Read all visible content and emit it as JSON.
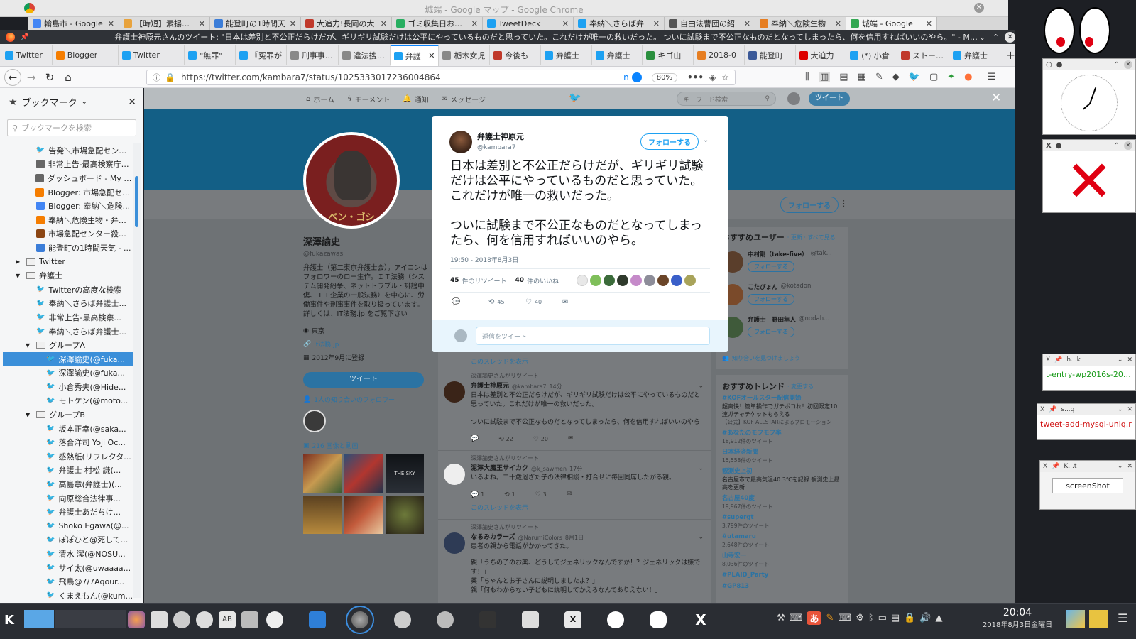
{
  "chrome": {
    "title": "城端 - Google マップ - Google Chrome",
    "tabs": [
      "輪島市 - Google",
      "【時短】素揚げさ",
      "能登町の1時間天",
      "大追力!長岡の大",
      "ゴミ収集日お知ら",
      "TweetDeck",
      "奉納＼さらば弁",
      "自由法曹団の紹",
      "奉納＼危険生物",
      "城端 - Google"
    ]
  },
  "firefox": {
    "title": "弁護士神原元さんのツイート: \"日本は差別と不公正だらけだが、ギリギリ試験だけは公平にやっているものだと思っていた。これだけが唯一の救いだった。 ついに試験まで不公正なものだとなってしまったら、何を信用すればいいのやら。\" - Mozilla Firefox",
    "tabs": [
      "Twitter",
      "Blogger",
      "Twitter",
      "\"無罪\"",
      "『冤罪が",
      "刑事事件の",
      "違法捜査で",
      "弁護",
      "栃木女児",
      "今後も",
      "弁護士",
      "弁護士",
      "キゴ山",
      "2018-0",
      "能登町",
      "大迫力",
      "(*) 小倉",
      "ストーカー",
      "弁護士"
    ],
    "url": "https://twitter.com/kambara7/status/1025333017236004864",
    "zoom": "80%",
    "url_badge": "n"
  },
  "sidebar": {
    "title": "ブックマーク",
    "search_placeholder": "ブックマークを検索",
    "items": [
      {
        "label": "告発＼市場急配センタ...",
        "indent": 3,
        "kind": "tw"
      },
      {
        "label": "非常上告-最高検察庁御...",
        "indent": 3,
        "kind": "globe"
      },
      {
        "label": "ダッシュボード - My Pro...",
        "indent": 3,
        "kind": "globe"
      },
      {
        "label": "Blogger: 市場急配セン...",
        "indent": 3,
        "kind": "blogger"
      },
      {
        "label": "Blogger: 奉納＼危険...",
        "indent": 3,
        "kind": "g"
      },
      {
        "label": "奉納＼危険生物・弁護...",
        "indent": 3,
        "kind": "blogger"
      },
      {
        "label": "市場急配センター殺人...",
        "indent": 3,
        "kind": "img"
      },
      {
        "label": "能登町の1時間天気 - ...",
        "indent": 3,
        "kind": "weather"
      },
      {
        "label": "Twitter",
        "indent": 2,
        "kind": "folder",
        "arrow": "▶"
      },
      {
        "label": "弁護士",
        "indent": 2,
        "kind": "folder",
        "arrow": "▼"
      },
      {
        "label": "Twitterの高度な検索",
        "indent": 3,
        "kind": "tw"
      },
      {
        "label": "奉納＼さらば弁護士...",
        "indent": 3,
        "kind": "tw"
      },
      {
        "label": "非常上告-最高検察...",
        "indent": 3,
        "kind": "tw"
      },
      {
        "label": "奉納＼さらば弁護士...",
        "indent": 3,
        "kind": "tw2"
      },
      {
        "label": "グループA",
        "indent": 3,
        "kind": "folder",
        "arrow": "▼"
      },
      {
        "label": "深澤諭史(@fuka...",
        "indent": 4,
        "kind": "tw",
        "selected": true
      },
      {
        "label": "深澤諭史(@fuka...",
        "indent": 4,
        "kind": "tw2"
      },
      {
        "label": "小倉秀夫(@Hide...",
        "indent": 4,
        "kind": "tw"
      },
      {
        "label": "モトケン(@moto...",
        "indent": 4,
        "kind": "tw"
      },
      {
        "label": "グループB",
        "indent": 3,
        "kind": "folder",
        "arrow": "▼"
      },
      {
        "label": "坂本正幸(@saka...",
        "indent": 4,
        "kind": "tw"
      },
      {
        "label": "落合洋司 Yoji Oc...",
        "indent": 4,
        "kind": "tw"
      },
      {
        "label": "感熱紙(リフレクタ...",
        "indent": 4,
        "kind": "tw"
      },
      {
        "label": "弁護士 村松 謙(...",
        "indent": 4,
        "kind": "tw"
      },
      {
        "label": "高島章(弁護士)(...",
        "indent": 4,
        "kind": "tw"
      },
      {
        "label": "向原総合法律事...",
        "indent": 4,
        "kind": "tw"
      },
      {
        "label": "弁護士あだちけ...",
        "indent": 4,
        "kind": "tw"
      },
      {
        "label": "Shoko Egawa(@...",
        "indent": 4,
        "kind": "tw"
      },
      {
        "label": "ぽぽひと@死して...",
        "indent": 4,
        "kind": "tw"
      },
      {
        "label": "清水 潔(@NOSU...",
        "indent": 4,
        "kind": "tw"
      },
      {
        "label": "サイ太(@uwaaaa...",
        "indent": 4,
        "kind": "tw"
      },
      {
        "label": "飛鳥@7/7Aqour...",
        "indent": 4,
        "kind": "tw"
      },
      {
        "label": "くまえもん(@kum...",
        "indent": 4,
        "kind": "tw"
      }
    ]
  },
  "twitter": {
    "nav": {
      "home": "ホーム",
      "moments": "モーメント",
      "notifications": "通知",
      "messages": "メッセージ",
      "search_placeholder": "キーワード検索",
      "tweet_button": "ツイート"
    },
    "profile": {
      "name": "深澤諭史",
      "handle": "@fukazawas",
      "bio": "弁護士（第二東京弁護士会）。アイコンはフォロワーのロー生作。ＩＴ法務（システム開発紛争、ネットトラブル・誹謗中傷、ＩＴ企業の一般法務）を中心に、労働事件や刑事事件を取り扱っています。詳しくは、IT法務.jp をご覧下さい",
      "location": "東京",
      "url": "it法務.jp",
      "joined": "2012年9月に登録",
      "tweet_button": "ツイート",
      "mutual": "1人の知り合いのフォロワー",
      "media": "216 画像と動画",
      "follow": "フォローする"
    },
    "modal": {
      "name": "弁護士神原元",
      "handle": "@kambara7",
      "follow": "フォローする",
      "para1": "日本は差別と不公正だらけだが、ギリギリ試験だけは公平にやっているものだと思っていた。これだけが唯一の救いだった。",
      "para2": "ついに試験まで不公正なものだとなってしまったら、何を信用すればいいのやら。",
      "time": "19:50 - 2018年8月3日",
      "rt_count": "45",
      "rt_label": "件のリツイート",
      "like_count": "40",
      "like_label": "件のいいね",
      "act_rt": "45",
      "act_like": "40",
      "reply_placeholder": "返信をツイート"
    },
    "timeline": [
      {
        "rt_by": "深澤諭史さんがリツイート",
        "name": "弁護士神原元",
        "handle": "@kambara7",
        "time": "14分",
        "text1": "日本は差別と不公正だらけだが、ギリギリ試験だけは公平にやっているものだと思っていた。これだけが唯一の救いだった。",
        "text2": "ついに試験まで不公正なものだとなってしまったら、何を信用すればいいのやら",
        "rt": "22",
        "like": "20"
      },
      {
        "rt_by": "深澤諭史さんがリツイート",
        "name": "泥濘大魔王サイカク",
        "handle": "@k_sawmen",
        "time": "17分",
        "text1": "いるよね。二十歳過ぎた子の法律相談・打合せに毎回同席したがる親。",
        "rt": "1",
        "reply": "1",
        "like": "3",
        "thread": "このスレッドを表示"
      },
      {
        "rt_by": "深澤諭史さんがリツイート",
        "name": "なるみカラーズ",
        "handle": "@NarumiColors",
        "time": "8月1日",
        "text1": "患者の親から電話がかかってきた。",
        "text2": "親「うちの子のお薬、どうしてジェネリックなんですか！？ジェネリックは嫌です！」",
        "text3": "薬「ちゃんとお子さんに説明しましたよ？」",
        "text4": "親「何もわからない子どもに説明してかえるなんてありえない！」"
      }
    ],
    "thread_link": "このスレッドを表示",
    "who_to_follow": {
      "title": "おすすめユーザー",
      "links": "· 更新 · すべて見る",
      "users": [
        {
          "name": "中村剛（take-five）",
          "handle": "@tak..."
        },
        {
          "name": "こたぴょん",
          "handle": "@kotadon"
        },
        {
          "name": "弁護士　野田隼人",
          "handle": "@nodah..."
        }
      ],
      "find": "知り合いを見つけましょう"
    },
    "trends": {
      "title": "おすすめトレンド",
      "change": "· 変更する",
      "items": [
        {
          "tag": "#KOFオールスター配信開始",
          "desc": "超爽快！簡単操作でガチボコれ！初回限定10連ガチャチケットもらえる",
          "promo": "【公式】KOF ALLSTARによるプロモーション"
        },
        {
          "tag": "#あなたのモフモフ率",
          "count": "18,912件のツイート"
        },
        {
          "tag": "日本経済新聞",
          "count": "15,558件のツイート"
        },
        {
          "tag": "観測史上初",
          "desc": "名古屋市で最高気温40.3℃を記録 観測史上最高を更新"
        },
        {
          "tag": "名古屋40度",
          "count": "19,967件のツイート"
        },
        {
          "tag": "#supergt",
          "count": "3,799件のツイート"
        },
        {
          "tag": "#utamaru",
          "count": "2,648件のツイート"
        },
        {
          "tag": "山寺宏一",
          "count": "8,036件のツイート"
        },
        {
          "tag": "#PLAID_Party"
        },
        {
          "tag": "#GP813"
        }
      ]
    }
  },
  "right_panel": {
    "w1_title": "h...k",
    "w1_text": "t-entry-wp2016s-201610",
    "w2_title": "s...q",
    "w2_text": "tweet-add-mysql-uniq.r",
    "w3_title": "K...t",
    "w3_button": "screenShot"
  },
  "taskbar": {
    "time": "20:04",
    "date": "2018年8月3日金曜日",
    "ime": "あ"
  }
}
